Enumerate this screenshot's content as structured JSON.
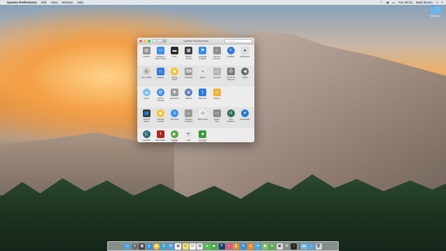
{
  "menubar": {
    "apple": "",
    "app": "System Preferences",
    "menus": [
      "Edit",
      "View",
      "Window",
      "Help"
    ],
    "clock": "Tue 09:23",
    "user": "Mark Brown"
  },
  "desktop": {
    "folder_label": "Desktop 1"
  },
  "window": {
    "title": "System Preferences",
    "search_placeholder": "Search",
    "sections": [
      {
        "panes": [
          {
            "id": "general",
            "label": "General",
            "icon": "general-icon",
            "color": "#8e8e93",
            "glyph": "▤"
          },
          {
            "id": "desktop",
            "label": "Desktop &\nScreen Saver",
            "icon": "desktop-screensaver-icon",
            "color": "#3a8ee6",
            "glyph": "▭"
          },
          {
            "id": "dock",
            "label": "Dock",
            "icon": "dock-icon",
            "color": "#2b2b2b",
            "glyph": "▬"
          },
          {
            "id": "mission",
            "label": "Mission\nControl",
            "icon": "mission-control-icon",
            "color": "#3d3d45",
            "glyph": "▦"
          },
          {
            "id": "language",
            "label": "Language\n& Region",
            "icon": "flag-icon",
            "color": "#3a8ee6",
            "glyph": "⚑"
          },
          {
            "id": "security",
            "label": "Security\n& Privacy",
            "icon": "house-icon",
            "color": "#8c8c8c",
            "glyph": "⌂"
          },
          {
            "id": "spotlight",
            "label": "Spotlight",
            "icon": "spotlight-icon",
            "color": "#3a7bd5",
            "glyph": "⌕",
            "round": true
          },
          {
            "id": "notifications",
            "label": "Notifications",
            "icon": "notifications-icon",
            "color": "#dcdcdc",
            "glyph": "●",
            "dark": true
          }
        ]
      },
      {
        "alt": true,
        "panes": [
          {
            "id": "cds",
            "label": "CDs & DVDs",
            "icon": "disc-icon",
            "color": "#cfcfcf",
            "glyph": "◎",
            "round": true,
            "dark": true
          },
          {
            "id": "displays",
            "label": "Displays",
            "icon": "display-icon",
            "color": "#2f7bd8",
            "glyph": "▭"
          },
          {
            "id": "energy",
            "label": "Energy\nSaver",
            "icon": "lightbulb-icon",
            "color": "#f2c230",
            "glyph": "◉",
            "round": true
          },
          {
            "id": "keyboard",
            "label": "Keyboard",
            "icon": "keyboard-icon",
            "color": "#9a9a9a",
            "glyph": "⌨"
          },
          {
            "id": "mouse",
            "label": "Mouse",
            "icon": "mouse-icon",
            "color": "#e6e6e6",
            "glyph": "◖",
            "dark": true
          },
          {
            "id": "trackpad",
            "label": "Trackpad",
            "icon": "trackpad-icon",
            "color": "#b5b5b5",
            "glyph": "▭"
          },
          {
            "id": "printers",
            "label": "Printers &\nScanners",
            "icon": "printer-icon",
            "color": "#7d7d7d",
            "glyph": "⎙"
          },
          {
            "id": "sound",
            "label": "Sound",
            "icon": "speaker-icon",
            "color": "#6b6b6b",
            "glyph": "◀",
            "round": true
          }
        ]
      },
      {
        "panes": [
          {
            "id": "icloud",
            "label": "iCloud",
            "icon": "cloud-icon",
            "color": "#7cc0f2",
            "glyph": "☁",
            "round": true
          },
          {
            "id": "internet",
            "label": "Internet\nAccounts",
            "icon": "at-icon",
            "color": "#3a8ee6",
            "glyph": "@",
            "round": true
          },
          {
            "id": "extensions",
            "label": "Extensions",
            "icon": "puzzle-icon",
            "color": "#9c9c9c",
            "glyph": "✚"
          },
          {
            "id": "network",
            "label": "Network",
            "icon": "globe-icon",
            "color": "#5b7fb5",
            "glyph": "◍",
            "round": true
          },
          {
            "id": "bluetooth",
            "label": "Bluetooth",
            "icon": "bluetooth-icon",
            "color": "#2f7bd8",
            "glyph": "ᛒ"
          },
          {
            "id": "sharing",
            "label": "Sharing",
            "icon": "sharing-icon",
            "color": "#f0b030",
            "glyph": "⚠"
          }
        ]
      },
      {
        "alt": true,
        "panes": [
          {
            "id": "users",
            "label": "Users &\nGroups",
            "icon": "users-icon",
            "color": "#3d3d3d",
            "glyph": "👥"
          },
          {
            "id": "parental",
            "label": "Parental\nControls",
            "icon": "parental-controls-icon",
            "color": "#f2c230",
            "glyph": "◉",
            "round": true
          },
          {
            "id": "appstore",
            "label": "App Store",
            "icon": "app-store-icon",
            "color": "#3a8ee6",
            "glyph": "A",
            "round": true
          },
          {
            "id": "dictation",
            "label": "Dictation\n& Speech",
            "icon": "microphone-icon",
            "color": "#9a9a9a",
            "glyph": "♪"
          },
          {
            "id": "datetime",
            "label": "Date & Time",
            "icon": "clock-icon",
            "color": "#f0f0f0",
            "glyph": "◷",
            "round": true,
            "dark": true
          },
          {
            "id": "startup",
            "label": "Startup\nDisk",
            "icon": "disk-icon",
            "color": "#8a8a8a",
            "glyph": "▭"
          },
          {
            "id": "timemachine",
            "label": "Time\nMachine",
            "icon": "time-machine-icon",
            "color": "#2f6d5a",
            "glyph": "↺",
            "round": true
          },
          {
            "id": "accessibility",
            "label": "Accessibility",
            "icon": "accessibility-icon",
            "color": "#2f7bd8",
            "glyph": "✦",
            "round": true
          }
        ]
      },
      {
        "panes": [
          {
            "id": "cutemarkr",
            "label": "CuteMarkr",
            "icon": "cutemarkr-icon",
            "color": "#2a6b74",
            "glyph": "C",
            "round": true
          },
          {
            "id": "flash",
            "label": "Flash Player",
            "icon": "flash-icon",
            "color": "#a82a22",
            "glyph": "f"
          },
          {
            "id": "flip4mac",
            "label": "Flip4Mac\nWMV",
            "icon": "flip4mac-icon",
            "color": "#5aa845",
            "glyph": "▶",
            "round": true
          },
          {
            "id": "java",
            "label": "Java",
            "icon": "java-icon",
            "color": "#e8e8e8",
            "glyph": "☕",
            "dark": true
          },
          {
            "id": "endpoint",
            "label": "Symantec\nEndpoint Protection",
            "icon": "shield-icon",
            "color": "#3a9a3a",
            "glyph": "■"
          }
        ]
      }
    ]
  },
  "dock": {
    "items": [
      {
        "name": "finder-icon",
        "color": "#4aa3e8",
        "glyph": "☺"
      },
      {
        "name": "launchpad-icon",
        "color": "#6a6a72",
        "glyph": "✈",
        "round": true
      },
      {
        "name": "mission-control-dock-icon",
        "color": "#45454f",
        "glyph": "▦"
      },
      {
        "name": "safari-icon",
        "color": "#2f8ee8",
        "glyph": "◎",
        "round": true
      },
      {
        "name": "chrome-icon",
        "color": "#f2c230",
        "glyph": "◉",
        "round": true
      },
      {
        "name": "skype-icon",
        "color": "#2aa8e8",
        "glyph": "S",
        "round": true
      },
      {
        "name": "mail-icon",
        "color": "#4b9ee8",
        "glyph": "✉"
      },
      {
        "name": "calendar-icon",
        "color": "#ffffff",
        "glyph": "▦",
        "dark": true
      },
      {
        "name": "notes-icon",
        "color": "#f6e070",
        "glyph": "≡",
        "dark": true
      },
      {
        "name": "reminders-icon",
        "color": "#f5f5f5",
        "glyph": "☑",
        "dark": true
      },
      {
        "name": "photos-icon",
        "color": "#e9e9e9",
        "glyph": "✿",
        "dark": true
      },
      {
        "name": "messages-icon",
        "color": "#4fc24f",
        "glyph": "●"
      },
      {
        "name": "facetime-icon",
        "color": "#3fae3f",
        "glyph": "▶"
      },
      {
        "name": "photoshop-icon",
        "color": "#1f3c66",
        "glyph": "P"
      },
      {
        "name": "itunes-icon",
        "color": "#e9508a",
        "glyph": "♪",
        "round": true
      },
      {
        "name": "ibooks-icon",
        "color": "#f08a24",
        "glyph": "▮"
      },
      {
        "name": "appstore-dock-icon",
        "color": "#2f8ee8",
        "glyph": "A",
        "round": true
      },
      {
        "name": "vlc-icon",
        "color": "#f08a24",
        "glyph": "▲"
      },
      {
        "name": "twitter-icon",
        "color": "#46a8e8",
        "glyph": "✦"
      },
      {
        "name": "maps-icon",
        "color": "#7cc26a",
        "glyph": "◆"
      },
      {
        "name": "evernote-icon",
        "color": "#57b04a",
        "glyph": "E"
      },
      {
        "name": "preview-icon",
        "color": "#dcdcdc",
        "glyph": "▣",
        "dark": true
      },
      {
        "name": "system-preferences-icon",
        "color": "#8c8c8c",
        "glyph": "⚙",
        "round": true
      },
      {
        "name": "terminal-icon",
        "color": "#2b2b2b",
        "glyph": "›"
      },
      {
        "sep": true
      },
      {
        "name": "folder-icon",
        "color": "#6cb6ee",
        "glyph": "▬"
      },
      {
        "name": "downloads-icon",
        "color": "#5aa6de",
        "glyph": "↓"
      },
      {
        "name": "trash-icon",
        "color": "#d6d6d6",
        "glyph": "🗑",
        "dark": true
      }
    ]
  }
}
